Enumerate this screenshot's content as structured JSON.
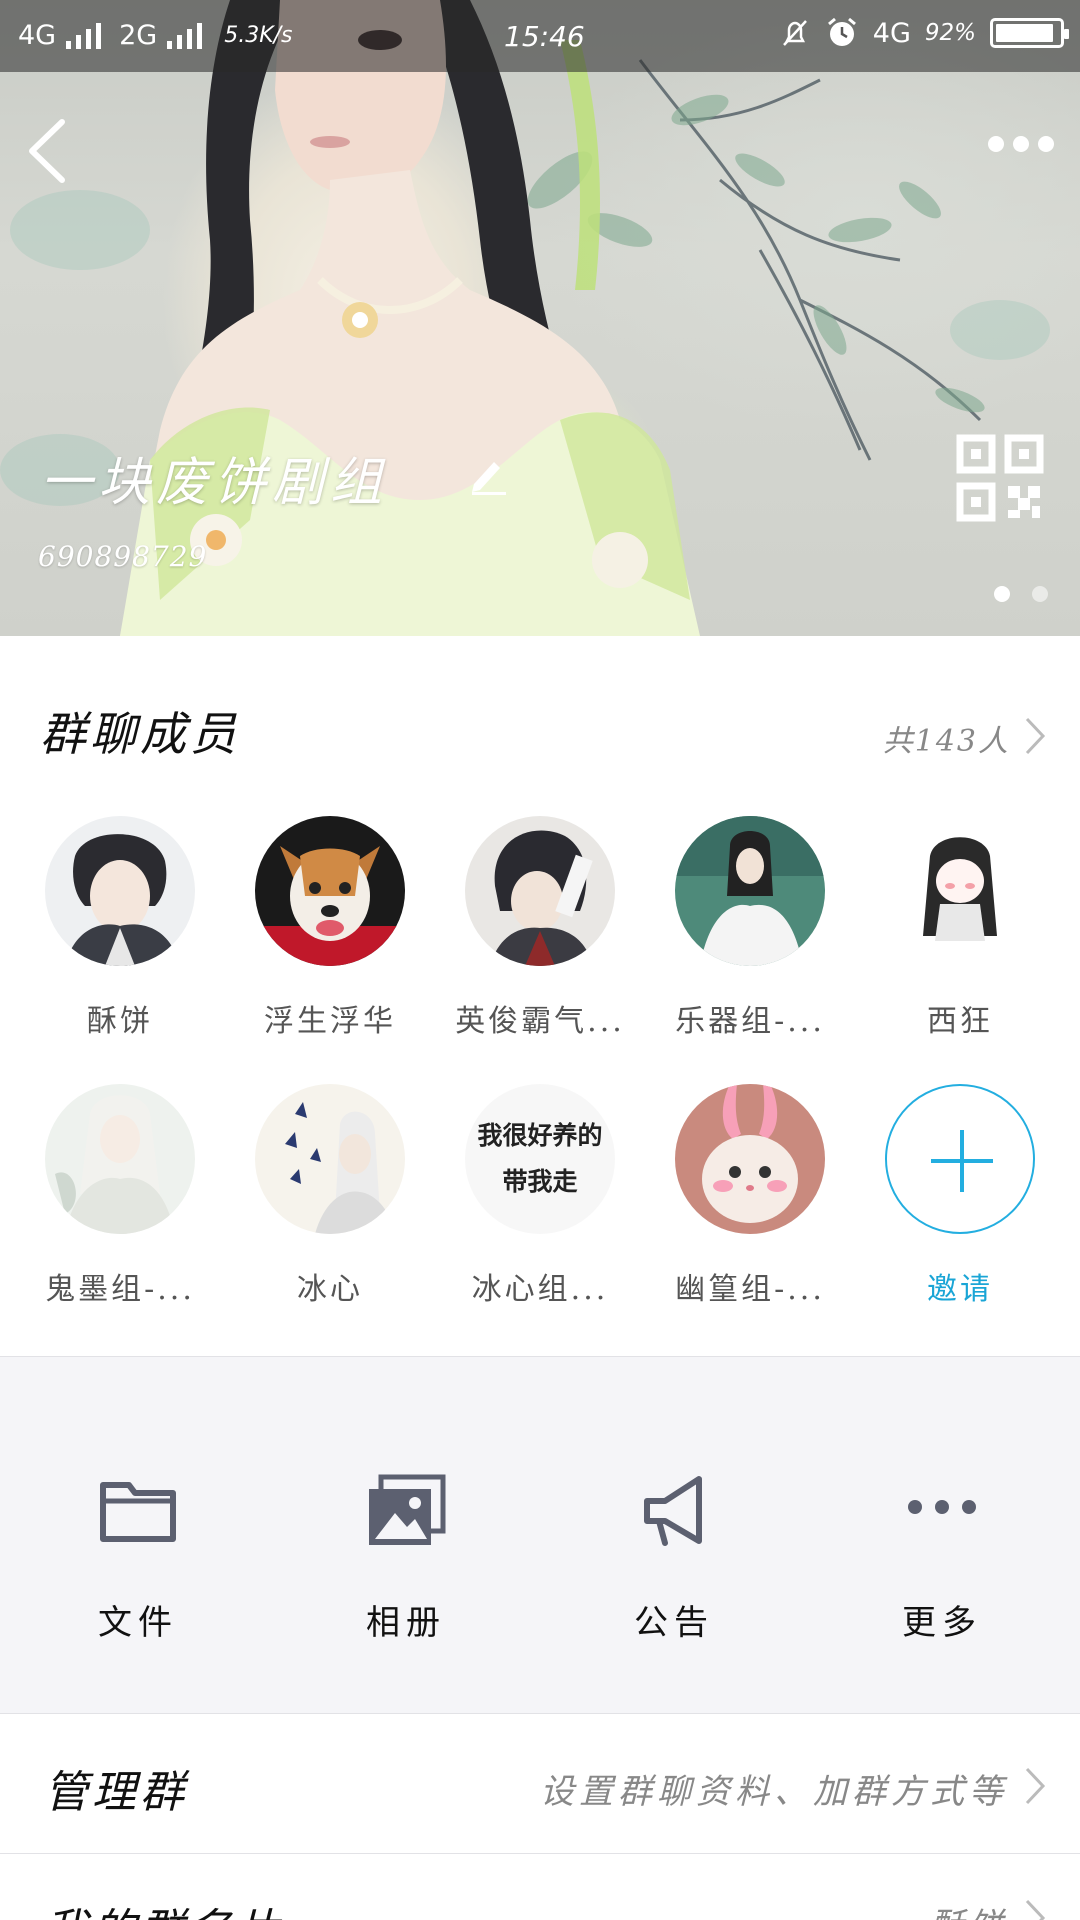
{
  "status_bar": {
    "network_1": "4G",
    "network_2": "2G",
    "speed": "5.3K/s",
    "time": "15:46",
    "network_3": "4G",
    "battery_percent": "92%",
    "battery_level": 0.92
  },
  "header": {
    "group_name": "一块废饼剧组",
    "group_id": "690898729",
    "page_count": 2,
    "active_page": 0
  },
  "members": {
    "title": "群聊成员",
    "count_label": "共143人",
    "list": [
      {
        "name": "酥饼"
      },
      {
        "name": "浮生浮华"
      },
      {
        "name": "英俊霸气..."
      },
      {
        "name": "乐器组-..."
      },
      {
        "name": "西狂"
      },
      {
        "name": "鬼墨组-..."
      },
      {
        "name": "冰心"
      },
      {
        "name": "冰心组..."
      },
      {
        "name": "幽篁组-..."
      }
    ],
    "text_avatar": {
      "line1": "我很好养的",
      "line2": "带我走"
    },
    "invite_label": "邀请",
    "accent_color": "#23aee0"
  },
  "tools": [
    {
      "label": "文件",
      "icon": "folder-icon"
    },
    {
      "label": "相册",
      "icon": "album-icon"
    },
    {
      "label": "公告",
      "icon": "megaphone-icon"
    },
    {
      "label": "更多",
      "icon": "more-dots-icon"
    }
  ],
  "rows": {
    "manage": {
      "title": "管理群",
      "value": "设置群聊资料、加群方式等"
    },
    "card": {
      "title": "我的群名片",
      "value": "酥饼"
    }
  }
}
